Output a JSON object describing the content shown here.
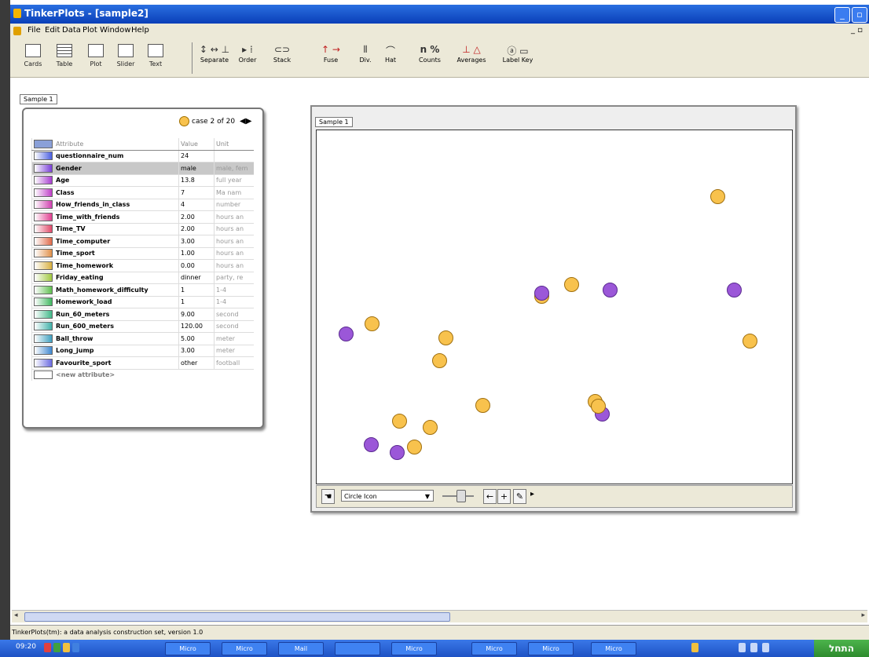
{
  "window": {
    "title": "TinkerPlots - [sample2]"
  },
  "menu": [
    "File",
    "Edit",
    "Data",
    "Plot",
    "Window",
    "Help"
  ],
  "menu_right": "_ ▫",
  "toolbar": {
    "left": [
      {
        "label": "Cards",
        "icon": "cards-icon"
      },
      {
        "label": "Table",
        "icon": "table-icon"
      },
      {
        "label": "Plot",
        "icon": "plot-icon"
      },
      {
        "label": "Slider",
        "icon": "slider-icon"
      },
      {
        "label": "Text",
        "icon": "text-icon"
      }
    ],
    "right": [
      {
        "label": "Separate",
        "glyph": "↕ ↔ ⊥"
      },
      {
        "label": "Order",
        "glyph": "▸ ⁞"
      },
      {
        "label": "Stack",
        "glyph": "⊂⊃"
      },
      {
        "label": "Fuse",
        "glyph": "↑ →"
      },
      {
        "label": "Div.",
        "glyph": "⫴"
      },
      {
        "label": "Hat",
        "glyph": "⌒"
      },
      {
        "label": "Counts",
        "glyph": "n %"
      },
      {
        "label": "Averages",
        "glyph": "⊥ △"
      },
      {
        "label": "Label Key",
        "glyph": "ⓐ ▭"
      }
    ]
  },
  "workspace_tab": "Sample 1",
  "card": {
    "case_text": "case 2 of 20",
    "headers": [
      "Attribute",
      "Value",
      "Unit"
    ],
    "rows": [
      {
        "name": "questionnaire_num",
        "value": "24",
        "unit": "",
        "color": "#4a5fe0"
      },
      {
        "name": "Gender",
        "value": "male",
        "unit": "male, fem",
        "color": "#7a3fd8",
        "selected": true
      },
      {
        "name": "Age",
        "value": "13.8",
        "unit": "full year",
        "color": "#a83fd0"
      },
      {
        "name": "Class",
        "value": "7",
        "unit": "Ma nam",
        "color": "#c03fc8"
      },
      {
        "name": "How_friends_in_class",
        "value": "4",
        "unit": "number",
        "color": "#d03fb0"
      },
      {
        "name": "Time_with_friends",
        "value": "2.00",
        "unit": "hours an",
        "color": "#e03f90"
      },
      {
        "name": "Time_TV",
        "value": "2.00",
        "unit": "hours an",
        "color": "#e04a6a"
      },
      {
        "name": "Time_computer",
        "value": "3.00",
        "unit": "hours an",
        "color": "#e06a4a"
      },
      {
        "name": "Time_sport",
        "value": "1.00",
        "unit": "hours an",
        "color": "#e0904a"
      },
      {
        "name": "Time_homework",
        "value": "0.00",
        "unit": "hours an",
        "color": "#d8b040"
      },
      {
        "name": "Friday_eating",
        "value": "dinner",
        "unit": "party, re",
        "color": "#a0c840"
      },
      {
        "name": "Math_homework_difficulty",
        "value": "1",
        "unit": "1-4",
        "color": "#60c050"
      },
      {
        "name": "Homework_load",
        "value": "1",
        "unit": "1-4",
        "color": "#40b860"
      },
      {
        "name": "Run_60_meters",
        "value": "9.00",
        "unit": "second",
        "color": "#40b888"
      },
      {
        "name": "Run_600_meters",
        "value": "120.00",
        "unit": "second",
        "color": "#40b0a8"
      },
      {
        "name": "Ball_throw",
        "value": "5.00",
        "unit": "meter",
        "color": "#40a0c0"
      },
      {
        "name": "Long_jump",
        "value": "3.00",
        "unit": "meter",
        "color": "#4088d0"
      },
      {
        "name": "Favourite_sport",
        "value": "other",
        "unit": "football",
        "color": "#6a6ae0"
      }
    ],
    "new_attribute": "<new attribute>"
  },
  "plot": {
    "tab": "Sample 1",
    "icon_select": "Circle Icon",
    "colors": {
      "female": "#f8c24d",
      "male": "#9b57d8"
    }
  },
  "chart_data": {
    "type": "scatter",
    "xlim": [
      0,
      100
    ],
    "ylim": [
      0,
      100
    ],
    "legend": "none",
    "points": [
      {
        "x": 84.4,
        "y": 81.3,
        "g": "female"
      },
      {
        "x": 53.6,
        "y": 56.4,
        "g": "female"
      },
      {
        "x": 47.3,
        "y": 52.9,
        "g": "female"
      },
      {
        "x": 47.3,
        "y": 54.0,
        "g": "male"
      },
      {
        "x": 61.7,
        "y": 54.7,
        "g": "male"
      },
      {
        "x": 87.9,
        "y": 54.7,
        "g": "male"
      },
      {
        "x": 6.2,
        "y": 42.4,
        "g": "male"
      },
      {
        "x": 11.7,
        "y": 45.3,
        "g": "female"
      },
      {
        "x": 27.2,
        "y": 41.3,
        "g": "female"
      },
      {
        "x": 25.9,
        "y": 34.7,
        "g": "female"
      },
      {
        "x": 91.1,
        "y": 40.4,
        "g": "female"
      },
      {
        "x": 34.9,
        "y": 22.2,
        "g": "female"
      },
      {
        "x": 58.6,
        "y": 23.3,
        "g": "female"
      },
      {
        "x": 60.0,
        "y": 19.6,
        "g": "male"
      },
      {
        "x": 59.3,
        "y": 21.8,
        "g": "female"
      },
      {
        "x": 17.5,
        "y": 17.6,
        "g": "female"
      },
      {
        "x": 23.9,
        "y": 15.8,
        "g": "female"
      },
      {
        "x": 11.5,
        "y": 11.1,
        "g": "male"
      },
      {
        "x": 16.9,
        "y": 8.7,
        "g": "male"
      },
      {
        "x": 20.6,
        "y": 10.4,
        "g": "female"
      }
    ]
  },
  "status": "TinkerPlots(tm): a data analysis construction set, version 1.0",
  "taskbar": {
    "clock": "09:20",
    "tasks": [
      "Micro",
      "Micro",
      "Mail",
      "",
      "Micro",
      "Micro",
      "Micro",
      "Micro"
    ],
    "start": "התחל"
  }
}
